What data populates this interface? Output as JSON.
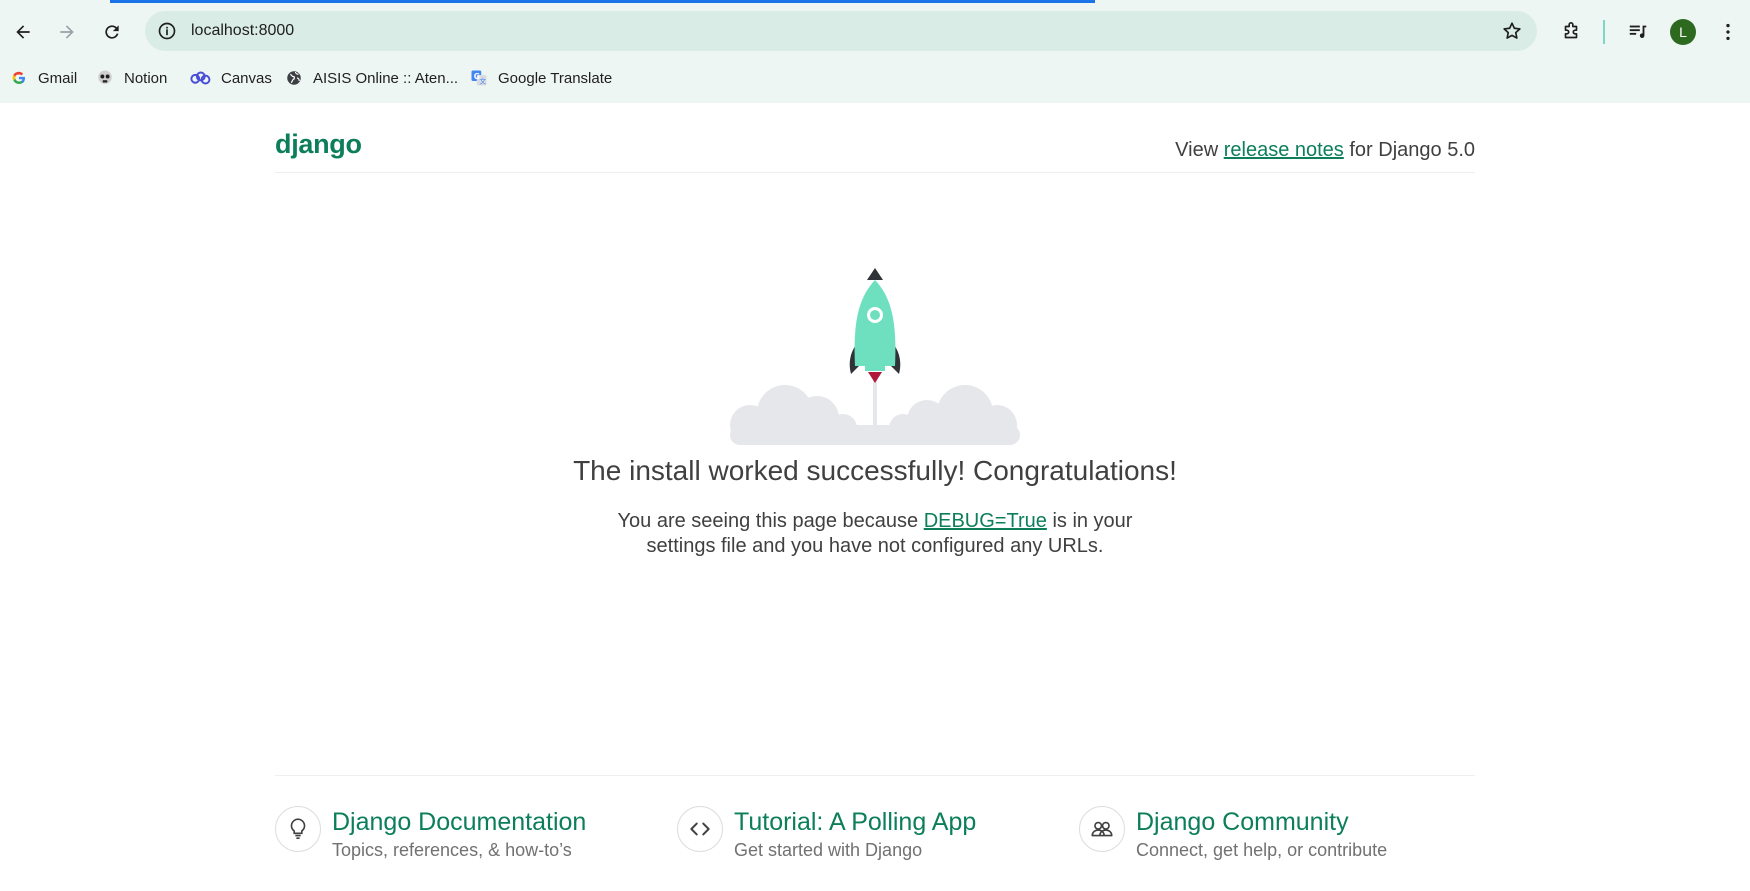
{
  "browser": {
    "url": "localhost:8000",
    "profile_initial": "L",
    "bookmarks": [
      {
        "label": "Gmail",
        "icon": "google-icon"
      },
      {
        "label": "Notion",
        "icon": "notion-icon"
      },
      {
        "label": "Canvas",
        "icon": "canvas-icon"
      },
      {
        "label": "AISIS Online :: Aten...",
        "icon": "globe-icon"
      },
      {
        "label": "Google Translate",
        "icon": "google-translate-icon"
      }
    ]
  },
  "header": {
    "logo": "django",
    "release_prefix": "View",
    "release_link": "release notes",
    "release_suffix": "for Django 5.0"
  },
  "main": {
    "title": "The install worked successfully! Congratulations!",
    "subtitle_prefix": "You are seeing this page because",
    "subtitle_link": "DEBUG=True",
    "subtitle_suffix": "is in your settings file and you have not configured any URLs."
  },
  "footer": {
    "cards": [
      {
        "title": "Django Documentation",
        "subtitle": "Topics, references, & how-to’s",
        "icon": "lightbulb-icon"
      },
      {
        "title": "Tutorial: A Polling App",
        "subtitle": "Get started with Django",
        "icon": "code-icon"
      },
      {
        "title": "Django Community",
        "subtitle": "Connect, get help, or contribute",
        "icon": "people-icon"
      }
    ]
  },
  "colors": {
    "brand": "#0c7e5a",
    "rocket": "#6ee0c0",
    "chrome_bg": "#eef6f3"
  }
}
